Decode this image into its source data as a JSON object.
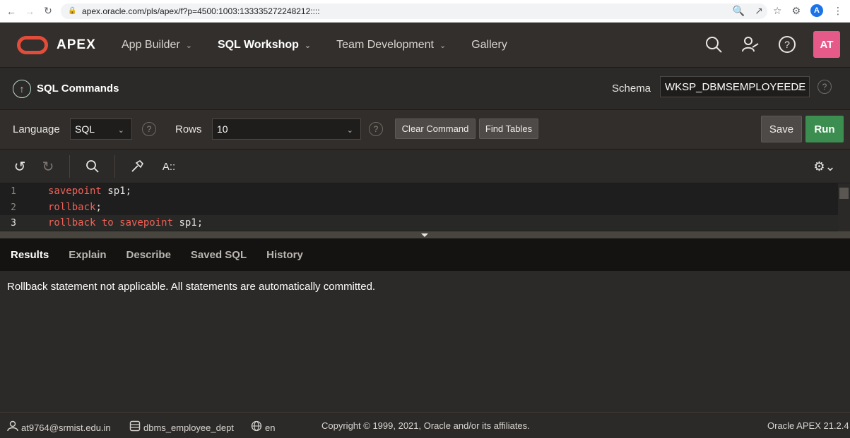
{
  "browser": {
    "url": "apex.oracle.com/pls/apex/f?p=4500:1003:133335272248212::::",
    "profile_initial": "A"
  },
  "header": {
    "logo_text": "APEX",
    "nav": [
      {
        "label": "App Builder"
      },
      {
        "label": "SQL Workshop"
      },
      {
        "label": "Team Development"
      },
      {
        "label": "Gallery"
      }
    ],
    "avatar_initials": "AT"
  },
  "page": {
    "title": "SQL Commands",
    "schema_label": "Schema",
    "schema_value": "WKSP_DBMSEMPLOYEEDE"
  },
  "toolbar": {
    "language_label": "Language",
    "language_value": "SQL",
    "rows_label": "Rows",
    "rows_value": "10",
    "clear_label": "Clear Command",
    "find_tables_label": "Find Tables",
    "save_label": "Save",
    "run_label": "Run"
  },
  "editor": {
    "text_size_label": "A::",
    "lines": [
      {
        "num": "1",
        "keyword": "savepoint",
        "rest": " sp1;"
      },
      {
        "num": "2",
        "keyword": "rollback",
        "rest": ";"
      },
      {
        "num": "3",
        "keyword": "rollback to savepoint",
        "rest": " sp1;"
      }
    ]
  },
  "results": {
    "tabs": [
      {
        "label": "Results"
      },
      {
        "label": "Explain"
      },
      {
        "label": "Describe"
      },
      {
        "label": "Saved SQL"
      },
      {
        "label": "History"
      }
    ],
    "message": "Rollback statement not applicable. All statements are automatically committed."
  },
  "footer": {
    "user": "at9764@srmist.edu.in",
    "workspace": "dbms_employee_dept",
    "language": "en",
    "copyright": "Copyright © 1999, 2021, Oracle and/or its affiliates.",
    "version": "Oracle APEX 21.2.4"
  },
  "colors": {
    "accent_run": "#3b8e4f",
    "logo": "#e24c3b",
    "avatar": "#e65a8a",
    "keyword": "#ef6157"
  }
}
